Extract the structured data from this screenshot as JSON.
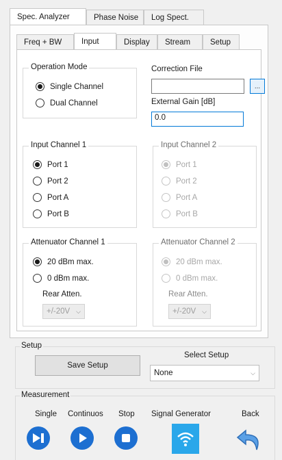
{
  "top_tabs": [
    {
      "label": "Spec. Analyzer",
      "active": true
    },
    {
      "label": "Phase Noise",
      "active": false
    },
    {
      "label": "Log Spect.",
      "active": false
    }
  ],
  "sub_tabs": [
    {
      "label": "Freq + BW",
      "active": false
    },
    {
      "label": "Input",
      "active": true
    },
    {
      "label": "Display",
      "active": false
    },
    {
      "label": "Stream",
      "active": false
    },
    {
      "label": "Setup",
      "active": false
    }
  ],
  "operation_mode": {
    "title": "Operation Mode",
    "options": [
      "Single Channel",
      "Dual Channel"
    ],
    "selected": "Single Channel"
  },
  "correction_file": {
    "label": "Correction File",
    "value": "",
    "browse_label": "..."
  },
  "external_gain": {
    "label": "External Gain [dB]",
    "value": "0.0"
  },
  "input_channel_1": {
    "title": "Input Channel 1",
    "options": [
      "Port 1",
      "Port 2",
      "Port A",
      "Port B"
    ],
    "selected": "Port 1",
    "enabled": true
  },
  "input_channel_2": {
    "title": "Input Channel 2",
    "options": [
      "Port 1",
      "Port 2",
      "Port A",
      "Port B"
    ],
    "selected": "Port 1",
    "enabled": false
  },
  "attenuator_channel_1": {
    "title": "Attenuator Channel 1",
    "options": [
      "20 dBm max.",
      "0 dBm max."
    ],
    "selected": "20 dBm max.",
    "rear_label": "Rear Atten.",
    "rear_value": "+/-20V",
    "enabled": true
  },
  "attenuator_channel_2": {
    "title": "Attenuator Channel 2",
    "options": [
      "20 dBm max.",
      "0 dBm max."
    ],
    "selected": "20 dBm max.",
    "rear_label": "Rear Atten.",
    "rear_value": "+/-20V",
    "enabled": false
  },
  "setup": {
    "title": "Setup",
    "save_label": "Save Setup",
    "select_label": "Select Setup",
    "select_value": "None"
  },
  "measurement": {
    "title": "Measurement",
    "single_label": "Single",
    "continuous_label": "Continuos",
    "stop_label": "Stop",
    "signal_generator_label": "Signal Generator",
    "back_label": "Back"
  },
  "icons": {
    "single": "skip-play-icon",
    "continuous": "play-icon",
    "stop": "stop-icon",
    "signal_generator": "wifi-signal-icon",
    "back": "back-arrow-icon"
  },
  "colors": {
    "accent": "#0078d7",
    "control_blue": "#1d6fd1",
    "signal_blue": "#2aa7ea"
  }
}
